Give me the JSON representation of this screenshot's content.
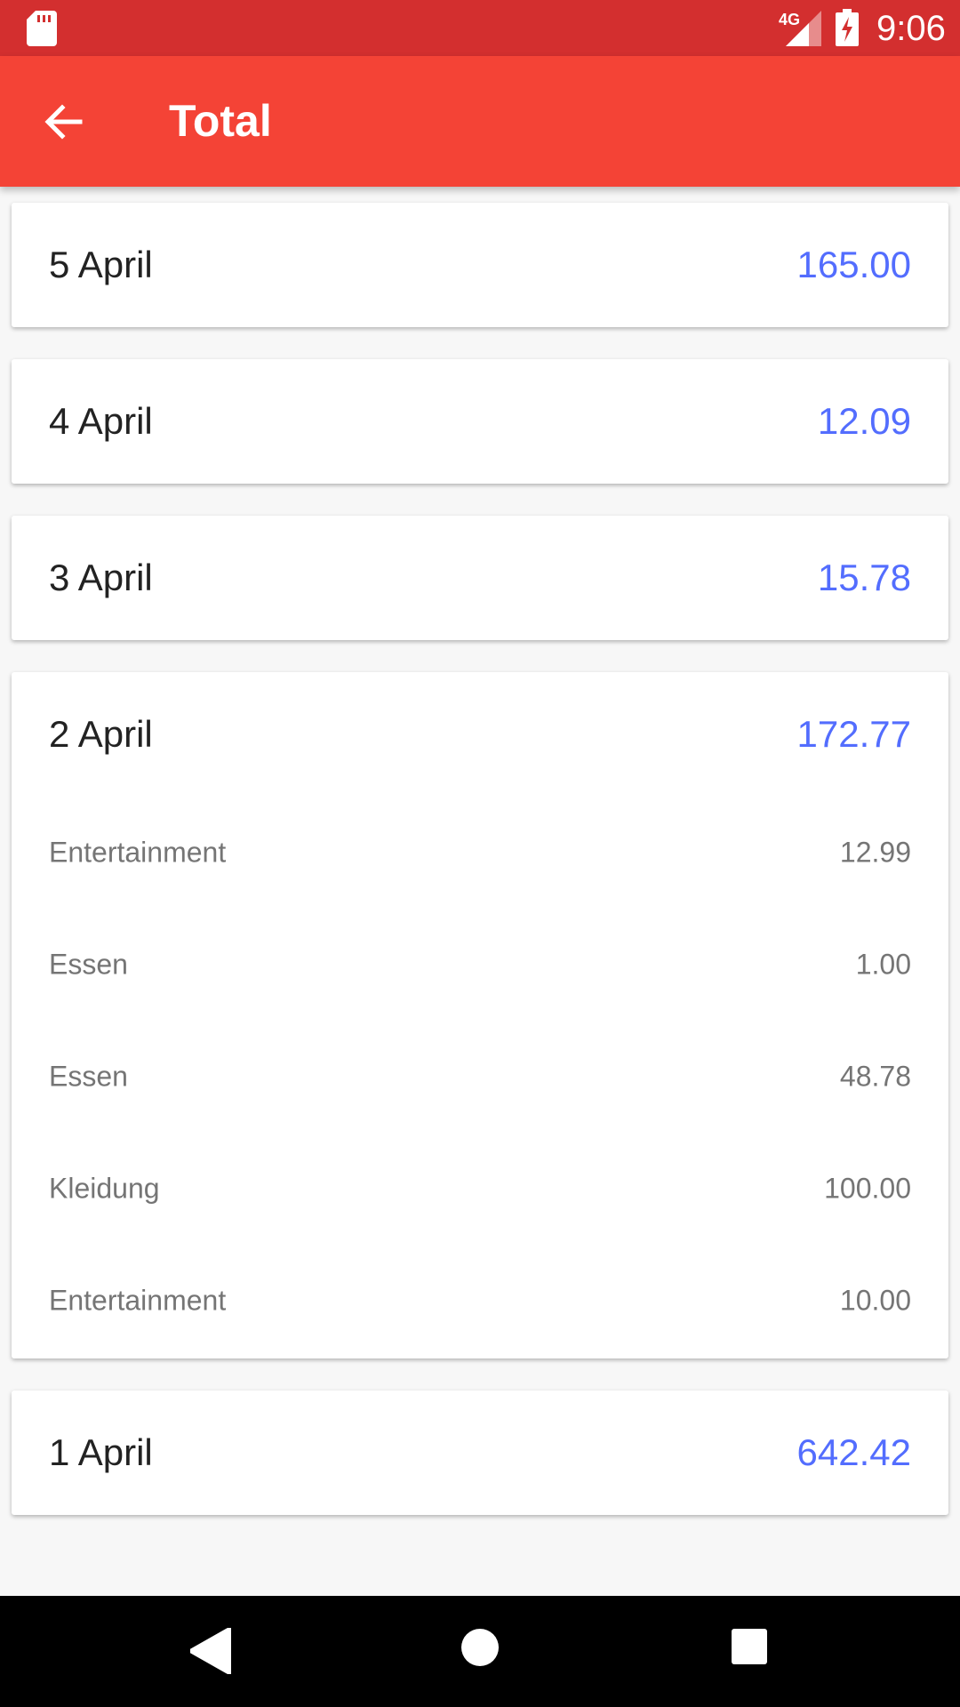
{
  "status": {
    "time": "9:06",
    "network": "4G",
    "icons": [
      "sd-card-icon",
      "signal-icon",
      "battery-charging-icon"
    ]
  },
  "toolbar": {
    "title": "Total",
    "back_icon": "arrow-left-icon",
    "color": "#f44336",
    "status_color": "#d32f2f"
  },
  "accent_color": "#536dfe",
  "days": [
    {
      "date": "5 April",
      "total": "165.00"
    },
    {
      "date": "4 April",
      "total": "12.09"
    },
    {
      "date": "3 April",
      "total": "15.78"
    },
    {
      "date": "2 April",
      "total": "172.77",
      "items": [
        {
          "category": "Entertainment",
          "amount": "12.99"
        },
        {
          "category": "Essen",
          "amount": "1.00"
        },
        {
          "category": "Essen",
          "amount": "48.78"
        },
        {
          "category": "Kleidung",
          "amount": "100.00"
        },
        {
          "category": "Entertainment",
          "amount": "10.00"
        }
      ]
    },
    {
      "date": "1 April",
      "total": "642.42"
    }
  ],
  "nav": {
    "icons": [
      "nav-back-icon",
      "nav-home-icon",
      "nav-recents-icon"
    ]
  }
}
